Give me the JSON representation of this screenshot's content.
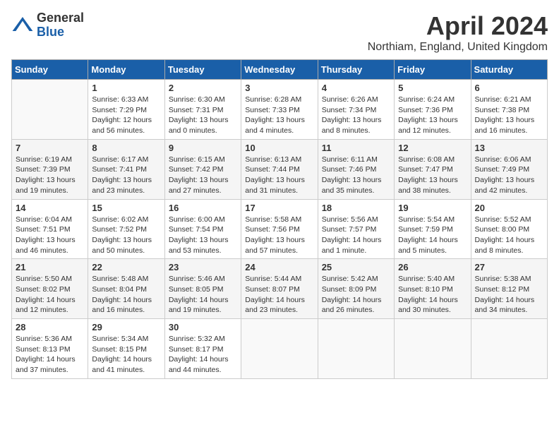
{
  "logo": {
    "general": "General",
    "blue": "Blue"
  },
  "title": "April 2024",
  "subtitle": "Northiam, England, United Kingdom",
  "days_header": [
    "Sunday",
    "Monday",
    "Tuesday",
    "Wednesday",
    "Thursday",
    "Friday",
    "Saturday"
  ],
  "weeks": [
    [
      {
        "num": "",
        "info": ""
      },
      {
        "num": "1",
        "info": "Sunrise: 6:33 AM\nSunset: 7:29 PM\nDaylight: 12 hours\nand 56 minutes."
      },
      {
        "num": "2",
        "info": "Sunrise: 6:30 AM\nSunset: 7:31 PM\nDaylight: 13 hours\nand 0 minutes."
      },
      {
        "num": "3",
        "info": "Sunrise: 6:28 AM\nSunset: 7:33 PM\nDaylight: 13 hours\nand 4 minutes."
      },
      {
        "num": "4",
        "info": "Sunrise: 6:26 AM\nSunset: 7:34 PM\nDaylight: 13 hours\nand 8 minutes."
      },
      {
        "num": "5",
        "info": "Sunrise: 6:24 AM\nSunset: 7:36 PM\nDaylight: 13 hours\nand 12 minutes."
      },
      {
        "num": "6",
        "info": "Sunrise: 6:21 AM\nSunset: 7:38 PM\nDaylight: 13 hours\nand 16 minutes."
      }
    ],
    [
      {
        "num": "7",
        "info": "Sunrise: 6:19 AM\nSunset: 7:39 PM\nDaylight: 13 hours\nand 19 minutes."
      },
      {
        "num": "8",
        "info": "Sunrise: 6:17 AM\nSunset: 7:41 PM\nDaylight: 13 hours\nand 23 minutes."
      },
      {
        "num": "9",
        "info": "Sunrise: 6:15 AM\nSunset: 7:42 PM\nDaylight: 13 hours\nand 27 minutes."
      },
      {
        "num": "10",
        "info": "Sunrise: 6:13 AM\nSunset: 7:44 PM\nDaylight: 13 hours\nand 31 minutes."
      },
      {
        "num": "11",
        "info": "Sunrise: 6:11 AM\nSunset: 7:46 PM\nDaylight: 13 hours\nand 35 minutes."
      },
      {
        "num": "12",
        "info": "Sunrise: 6:08 AM\nSunset: 7:47 PM\nDaylight: 13 hours\nand 38 minutes."
      },
      {
        "num": "13",
        "info": "Sunrise: 6:06 AM\nSunset: 7:49 PM\nDaylight: 13 hours\nand 42 minutes."
      }
    ],
    [
      {
        "num": "14",
        "info": "Sunrise: 6:04 AM\nSunset: 7:51 PM\nDaylight: 13 hours\nand 46 minutes."
      },
      {
        "num": "15",
        "info": "Sunrise: 6:02 AM\nSunset: 7:52 PM\nDaylight: 13 hours\nand 50 minutes."
      },
      {
        "num": "16",
        "info": "Sunrise: 6:00 AM\nSunset: 7:54 PM\nDaylight: 13 hours\nand 53 minutes."
      },
      {
        "num": "17",
        "info": "Sunrise: 5:58 AM\nSunset: 7:56 PM\nDaylight: 13 hours\nand 57 minutes."
      },
      {
        "num": "18",
        "info": "Sunrise: 5:56 AM\nSunset: 7:57 PM\nDaylight: 14 hours\nand 1 minute."
      },
      {
        "num": "19",
        "info": "Sunrise: 5:54 AM\nSunset: 7:59 PM\nDaylight: 14 hours\nand 5 minutes."
      },
      {
        "num": "20",
        "info": "Sunrise: 5:52 AM\nSunset: 8:00 PM\nDaylight: 14 hours\nand 8 minutes."
      }
    ],
    [
      {
        "num": "21",
        "info": "Sunrise: 5:50 AM\nSunset: 8:02 PM\nDaylight: 14 hours\nand 12 minutes."
      },
      {
        "num": "22",
        "info": "Sunrise: 5:48 AM\nSunset: 8:04 PM\nDaylight: 14 hours\nand 16 minutes."
      },
      {
        "num": "23",
        "info": "Sunrise: 5:46 AM\nSunset: 8:05 PM\nDaylight: 14 hours\nand 19 minutes."
      },
      {
        "num": "24",
        "info": "Sunrise: 5:44 AM\nSunset: 8:07 PM\nDaylight: 14 hours\nand 23 minutes."
      },
      {
        "num": "25",
        "info": "Sunrise: 5:42 AM\nSunset: 8:09 PM\nDaylight: 14 hours\nand 26 minutes."
      },
      {
        "num": "26",
        "info": "Sunrise: 5:40 AM\nSunset: 8:10 PM\nDaylight: 14 hours\nand 30 minutes."
      },
      {
        "num": "27",
        "info": "Sunrise: 5:38 AM\nSunset: 8:12 PM\nDaylight: 14 hours\nand 34 minutes."
      }
    ],
    [
      {
        "num": "28",
        "info": "Sunrise: 5:36 AM\nSunset: 8:13 PM\nDaylight: 14 hours\nand 37 minutes."
      },
      {
        "num": "29",
        "info": "Sunrise: 5:34 AM\nSunset: 8:15 PM\nDaylight: 14 hours\nand 41 minutes."
      },
      {
        "num": "30",
        "info": "Sunrise: 5:32 AM\nSunset: 8:17 PM\nDaylight: 14 hours\nand 44 minutes."
      },
      {
        "num": "",
        "info": ""
      },
      {
        "num": "",
        "info": ""
      },
      {
        "num": "",
        "info": ""
      },
      {
        "num": "",
        "info": ""
      }
    ]
  ]
}
